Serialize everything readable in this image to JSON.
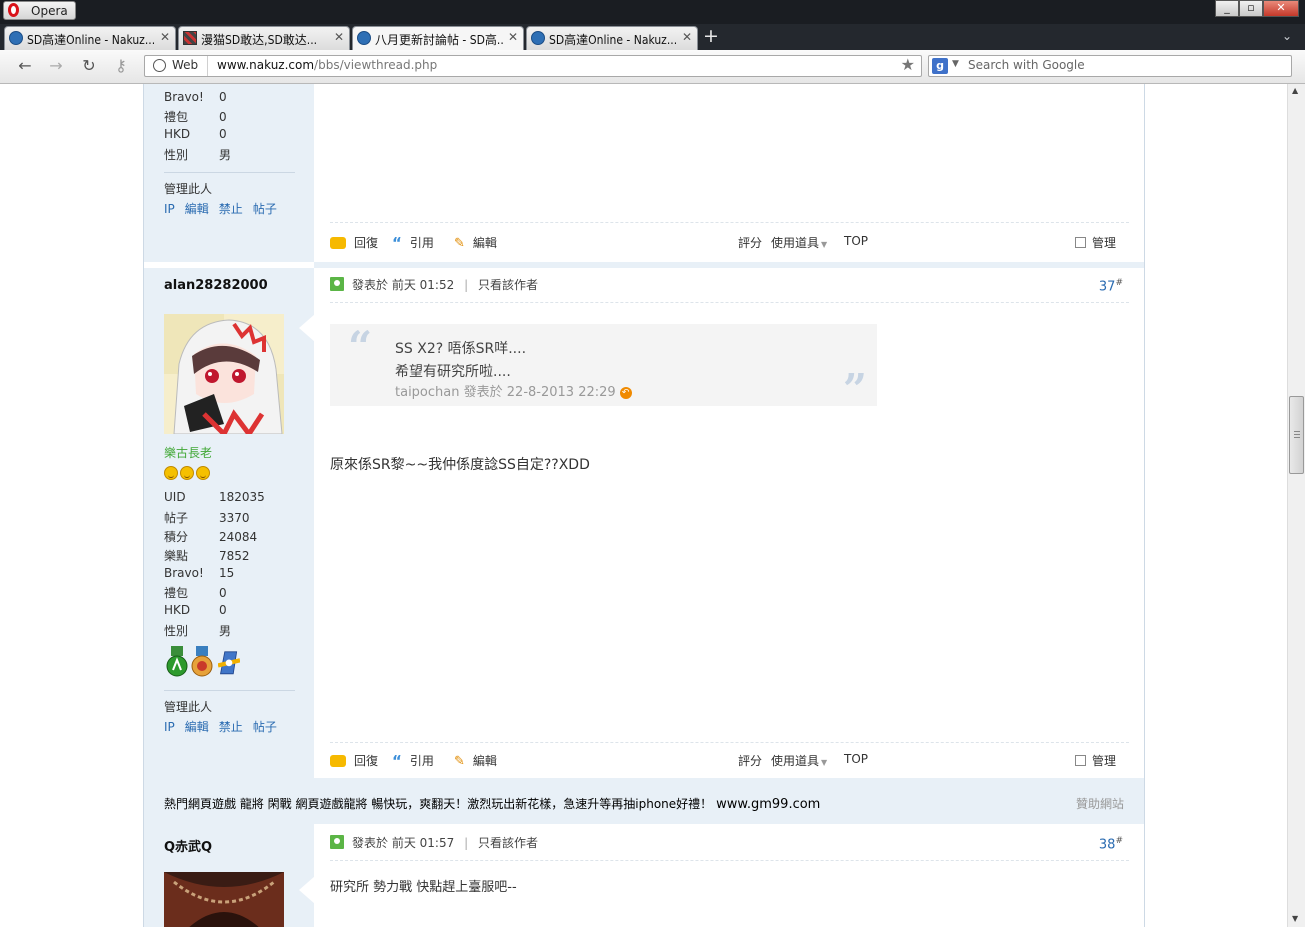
{
  "browser": {
    "app_name": "Opera",
    "tabs": [
      {
        "label": "SD高達Online - Nakuz..."
      },
      {
        "label": "漫猫SD敢达,SD敢达..."
      },
      {
        "label": "八月更新討論帖 - SD高..."
      },
      {
        "label": "SD高達Online - Nakuz..."
      }
    ],
    "address": {
      "mode_label": "Web",
      "url_host": "www.nakuz.com",
      "url_path": "/bbs/viewthread.php"
    },
    "search": {
      "placeholder": "Search with Google",
      "engine_letter": "g"
    }
  },
  "post_prev": {
    "stats": [
      {
        "k": "Bravo!",
        "v": "0"
      },
      {
        "k": "禮包",
        "v": "0"
      },
      {
        "k": "HKD",
        "v": "0"
      },
      {
        "k": "性別",
        "v": "男"
      }
    ],
    "manage_title": "管理此人",
    "manage_links": [
      "IP",
      "編輯",
      "禁止",
      "帖子"
    ],
    "actions": {
      "reply": "回復",
      "quote": "引用",
      "edit": "編輯",
      "rate": "評分",
      "tools": "使用道具",
      "top": "TOP",
      "manage": "管理"
    }
  },
  "post_37": {
    "username": "alan28282000",
    "rank": "樂古長老",
    "stats": [
      {
        "k": "UID",
        "v": "182035"
      },
      {
        "k": "帖子",
        "v": "3370"
      },
      {
        "k": "積分",
        "v": "24084"
      },
      {
        "k": "樂點",
        "v": "7852"
      },
      {
        "k": "Bravo!",
        "v": "15"
      },
      {
        "k": "禮包",
        "v": "0"
      },
      {
        "k": "HKD",
        "v": "0"
      },
      {
        "k": "性別",
        "v": "男"
      }
    ],
    "manage_title": "管理此人",
    "manage_links": [
      "IP",
      "編輯",
      "禁止",
      "帖子"
    ],
    "posted_label": "發表於",
    "posted_time": "前天 01:52",
    "author_only": "只看該作者",
    "floor": "37",
    "quote": {
      "line1": "SS X2? 唔係SR咩....",
      "line2": "希望有研究所啦....",
      "author": "taipochan",
      "posted_label": "發表於",
      "time": "22-8-2013 22:29"
    },
    "body": "原來係SR黎~~我仲係度諗SS自定??XDD",
    "actions": {
      "reply": "回復",
      "quote": "引用",
      "edit": "編輯",
      "rate": "評分",
      "tools": "使用道具",
      "top": "TOP",
      "manage": "管理"
    }
  },
  "ad": {
    "text": "熱門網頁遊戲 龍將 閑戰 網頁遊戲龍將 暢快玩，爽翻天！激烈玩出新花樣，急速升等再抽iphone好禮！",
    "domain": "www.gm99.com",
    "sponsor": "贊助網站"
  },
  "post_38": {
    "username": "Q赤武Q",
    "posted_label": "發表於",
    "posted_time": "前天 01:57",
    "author_only": "只看該作者",
    "floor": "38",
    "body": "研究所 勢力戰 快點趕上臺服吧--"
  },
  "colors": {
    "link": "#2a6bb1",
    "sidebar": "#e8f0f7",
    "rank": "#41a836"
  }
}
